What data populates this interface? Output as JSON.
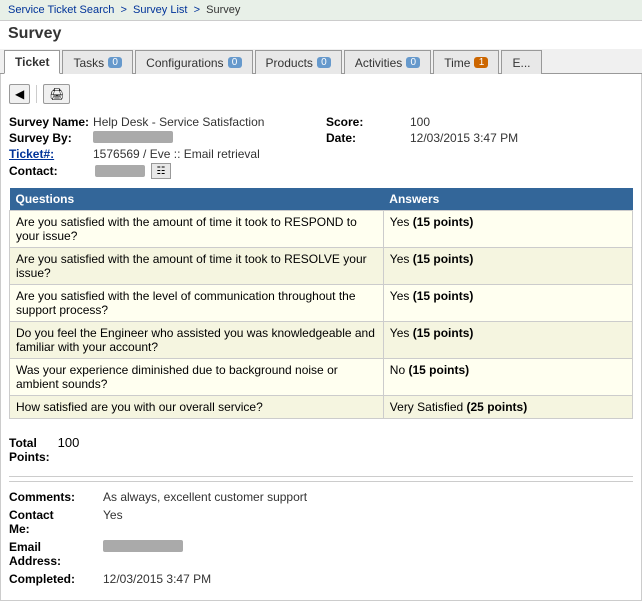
{
  "breadcrumb": {
    "items": [
      {
        "label": "Service Ticket Search",
        "link": true
      },
      {
        "label": "Survey List",
        "link": true
      },
      {
        "label": "Survey",
        "link": false
      }
    ]
  },
  "page": {
    "title": "Survey"
  },
  "tabs": [
    {
      "label": "Ticket",
      "badge": null,
      "active": true
    },
    {
      "label": "Tasks",
      "badge": "0",
      "active": false
    },
    {
      "label": "Configurations",
      "badge": "0",
      "active": false
    },
    {
      "label": "Products",
      "badge": "0",
      "active": false
    },
    {
      "label": "Activities",
      "badge": "0",
      "active": false
    },
    {
      "label": "Time",
      "badge": "1",
      "badge_color": "orange",
      "active": false
    },
    {
      "label": "E...",
      "badge": null,
      "active": false
    }
  ],
  "survey": {
    "name_label": "Survey Name:",
    "name_value": "Help Desk - Service Satisfaction",
    "by_label": "Survey By:",
    "score_label": "Score:",
    "score_value": "100",
    "date_label": "Date:",
    "date_value": "12/03/2015 3:47 PM",
    "ticket_label": "Ticket#:",
    "ticket_value": "1576569 / Eve :: Email retrieval",
    "contact_label": "Contact:"
  },
  "table": {
    "headers": [
      "Questions",
      "Answers"
    ],
    "rows": [
      {
        "question": "Are you satisfied with the amount of time it took to RESPOND to your issue?",
        "answer": "Yes ",
        "answer_bold": "(15 points)"
      },
      {
        "question": "Are you satisfied with the amount of time it took to RESOLVE your issue?",
        "answer": "Yes ",
        "answer_bold": "(15 points)"
      },
      {
        "question": "Are you satisfied with the level of communication throughout the support process?",
        "answer": "Yes ",
        "answer_bold": "(15 points)"
      },
      {
        "question": "Do you feel the Engineer who assisted you was knowledgeable and familiar with your account?",
        "answer": "Yes ",
        "answer_bold": "(15 points)"
      },
      {
        "question": "Was your experience diminished due to background noise or ambient sounds?",
        "answer": "No ",
        "answer_bold": "(15 points)"
      },
      {
        "question": "How satisfied are you with our overall service?",
        "answer": "Very Satisfied ",
        "answer_bold": "(25 points)"
      }
    ]
  },
  "totals": {
    "label": "Total\nPoints:",
    "label1": "Total",
    "label2": "Points:",
    "value": "100"
  },
  "comments": {
    "label": "Comments:",
    "value": "As always, excellent customer support",
    "contact_me_label": "Contact\nMe:",
    "contact_me_label1": "Contact",
    "contact_me_label2": "Me:",
    "contact_me_value": "Yes",
    "email_label": "Email\nAddress:",
    "email_label1": "Email",
    "email_label2": "Address:",
    "completed_label": "Completed:",
    "completed_value": "12/03/2015 3:47 PM"
  }
}
